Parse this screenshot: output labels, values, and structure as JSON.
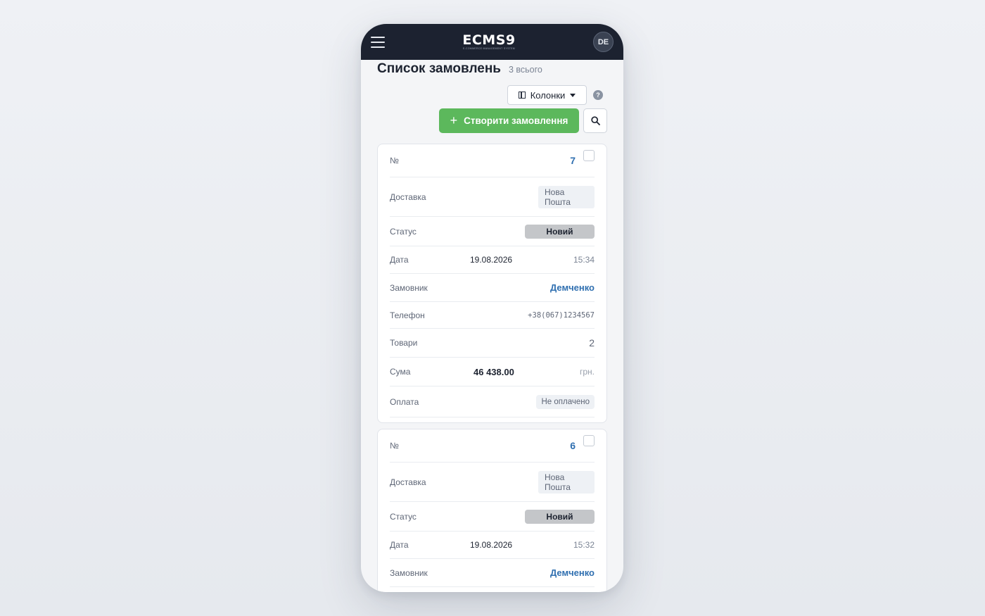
{
  "header": {
    "logo_text": "ECMS9",
    "logo_sub": "E-COMMERCE MANAGEMENT SYSTEM",
    "avatar_initials": "DE"
  },
  "page": {
    "title": "Список замовлень",
    "total_count": "3 всього"
  },
  "toolbar": {
    "columns_label": "Колонки",
    "help_label": "?",
    "create_label": "Створити замовлення",
    "create_plus": "+"
  },
  "labels": {
    "number": "№",
    "delivery": "Доставка",
    "status": "Статус",
    "date": "Дата",
    "customer": "Замовник",
    "phone": "Телефон",
    "items": "Товари",
    "sum": "Сума",
    "payment": "Оплата"
  },
  "orders": [
    {
      "number": "7",
      "delivery": "Нова Пошта",
      "status": "Новий",
      "date": "19.08.2026",
      "time": "15:34",
      "customer": "Демченко",
      "phone": "+38(067)1234567",
      "items": "2",
      "sum": "46 438.00",
      "currency": "грн.",
      "payment": "Не оплачено"
    },
    {
      "number": "6",
      "delivery": "Нова Пошта",
      "status": "Новий",
      "date": "19.08.2026",
      "time": "15:32",
      "customer": "Демченко"
    }
  ],
  "colors": {
    "header_bg": "#1c2230",
    "accent_green": "#5cb85c",
    "link_blue": "#2f6fb0",
    "status_gray": "#c4c6c9"
  }
}
